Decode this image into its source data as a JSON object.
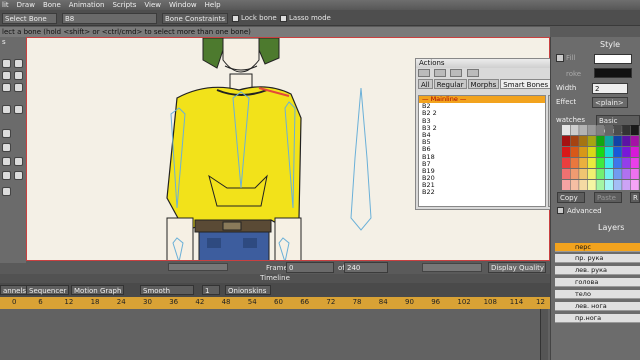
{
  "menu": [
    "lit",
    "Draw",
    "Bone",
    "Animation",
    "Scripts",
    "View",
    "Window",
    "Help"
  ],
  "toolbar": {
    "tool_label": "Select Bone",
    "bone_field": "B8",
    "constraints_button": "Bone Constraints",
    "lock_bone": "Lock bone",
    "lasso_mode": "Lasso mode"
  },
  "hint": "lect a bone (hold <shift> or <ctrl/cmd> to select more than one bone)",
  "left_header": "s",
  "actions": {
    "title": "Actions",
    "tabs": [
      "All",
      "Regular",
      "Morphs",
      "Smart Bones"
    ],
    "mainline": "— Mainline —",
    "items": [
      "B2",
      "B2 2",
      "B3",
      "B3 2",
      "B4",
      "B5",
      "B6",
      "B18",
      "B7",
      "B19",
      "B20",
      "B21",
      "B22"
    ]
  },
  "right": {
    "style_title": "Style",
    "fill_label": "Fill",
    "stroke_label": "roke",
    "width_label": "Width",
    "width_value": "2",
    "effect_label": "Effect",
    "effect_value": "<plain>",
    "swatches_label": "watches",
    "swatches_file": "Basic Colors.p",
    "copy": "Copy",
    "paste": "Paste",
    "reset": "R",
    "advanced": "Advanced",
    "layers_title": "Layers",
    "layers": [
      "перс",
      "пр. рука",
      "лев. рука",
      "голова",
      "тело",
      "лев. нога",
      "пр.нога"
    ]
  },
  "transport": {
    "frame_label": "Frame",
    "frame_value": "0",
    "of_label": "of",
    "total": "240",
    "display_quality": "Display Quality"
  },
  "timeline": {
    "title": "Timeline",
    "tabs": [
      "annels",
      "Sequencer",
      "Motion Graph"
    ],
    "interp": "Smooth",
    "interp_val": "1",
    "onionskins": "Onionskins",
    "ruler": [
      "0",
      "6",
      "12",
      "18",
      "24",
      "30",
      "36",
      "42",
      "48",
      "54",
      "60",
      "66",
      "72",
      "78",
      "84",
      "90",
      "96",
      "102",
      "108",
      "114",
      "12"
    ]
  },
  "colors": {
    "shirt": "#f2e21a",
    "hair": "#4d7a2e",
    "jeans": "#3d5d9e",
    "selected_bone": "#e34a3a",
    "accent": "#f2a31e"
  }
}
